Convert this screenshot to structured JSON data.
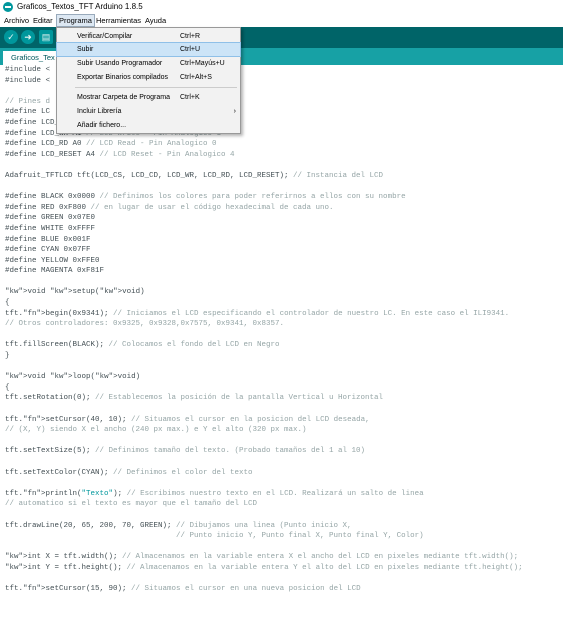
{
  "window": {
    "title": "Graficos_Textos_TFT Arduino 1.8.5"
  },
  "menubar": {
    "items": [
      "Archivo",
      "Editar",
      "Programa",
      "Herramientas",
      "Ayuda"
    ],
    "active": "Programa"
  },
  "toolbar": {
    "verify_icon": "check-icon",
    "upload_icon": "arrow-right-icon",
    "new_icon": "file-icon"
  },
  "tabs": [
    {
      "label": "Graficos_Tex"
    }
  ],
  "menu": {
    "items": [
      {
        "label": "Verificar/Compilar",
        "shortcut": "Ctrl+R"
      },
      {
        "label": "Subir",
        "shortcut": "Ctrl+U",
        "highlighted": true
      },
      {
        "label": "Subir Usando Programador",
        "shortcut": "Ctrl+Mayús+U"
      },
      {
        "label": "Exportar Binarios compilados",
        "shortcut": "Ctrl+Alt+S"
      },
      {
        "label": "Mostrar Carpeta de Programa",
        "shortcut": "Ctrl+K"
      },
      {
        "label": "Incluir Librería",
        "shortcut": "",
        "submenu": true
      },
      {
        "label": "Añadir fichero...",
        "shortcut": ""
      }
    ]
  },
  "code_lines": [
    "#include <                                  ficos",
    "#include <",
    "",
    "// Pines d",
    "#define LC                                 o 3",
    "#define LCD_CD A2  // Command/Data - Pin Analogico 2",
    "#define LCD_WR A1 // LCD Write - Pin Analogico 1",
    "#define LCD_RD A0 // LCD Read - Pin Analogico 0",
    "#define LCD_RESET A4 // LCD Reset - Pin Analogico 4",
    "",
    "Adafruit_TFTLCD tft(LCD_CS, LCD_CD, LCD_WR, LCD_RD, LCD_RESET); // Instancia del LCD",
    "",
    "#define BLACK 0x0000 // Definimos los colores para poder referirnos a ellos con su nombre",
    "#define RED 0xF800 // en lugar de usar el código hexadecimal de cada uno.",
    "#define GREEN 0x07E0",
    "#define WHITE 0xFFFF",
    "#define BLUE 0x001F",
    "#define CYAN 0x07FF",
    "#define YELLOW 0xFFE0",
    "#define MAGENTA 0xF81F",
    "",
    "void setup(void)",
    "{",
    "tft.begin(0x9341); // Iniciamos el LCD especificando el controlador de nuestro LC. En este caso el ILI9341.",
    "// Otros controladores: 0x9325, 0x9328,0x7575, 0x9341, 0x8357.",
    "",
    "tft.fillScreen(BLACK); // Colocamos el fondo del LCD en Negro",
    "}",
    "",
    "void loop(void)",
    "{",
    "tft.setRotation(0); // Establecemos la posición de la pantalla Vertical u Horizontal",
    "",
    "tft.setCursor(40, 10); // Situamos el cursor en la posicion del LCD deseada,",
    "// (X, Y) siendo X el ancho (240 px max.) e Y el alto (320 px max.)",
    "",
    "tft.setTextSize(5); // Definimos tamaño del texto. (Probado tamaños del 1 al 10)",
    "",
    "tft.setTextColor(CYAN); // Definimos el color del texto",
    "",
    "tft.println(\"Texto\"); // Escribimos nuestro texto en el LCD. Realizará un salto de linea",
    "// automatico si el texto es mayor que el tamaño del LCD",
    "",
    "tft.drawLine(20, 65, 200, 70, GREEN); // Dibujamos una linea (Punto inicio X,",
    "                                      // Punto inicio Y, Punto final X, Punto final Y, Color)",
    "",
    "int X = tft.width(); // Almacenamos en la variable entera X el ancho del LCD en pixeles mediante tft.width();",
    "int Y = tft.height(); // Almacenamos en la variable entera Y el alto del LCD en pixeles mediante tft.height();",
    "",
    "tft.setCursor(15, 90); // Situamos el cursor en una nueva posicion del LCD"
  ],
  "colors": {
    "toolbar": "#006468",
    "tabbar": "#17a1a5",
    "keyword": "#00979c",
    "function": "#d35400",
    "comment": "#95a5a6"
  }
}
